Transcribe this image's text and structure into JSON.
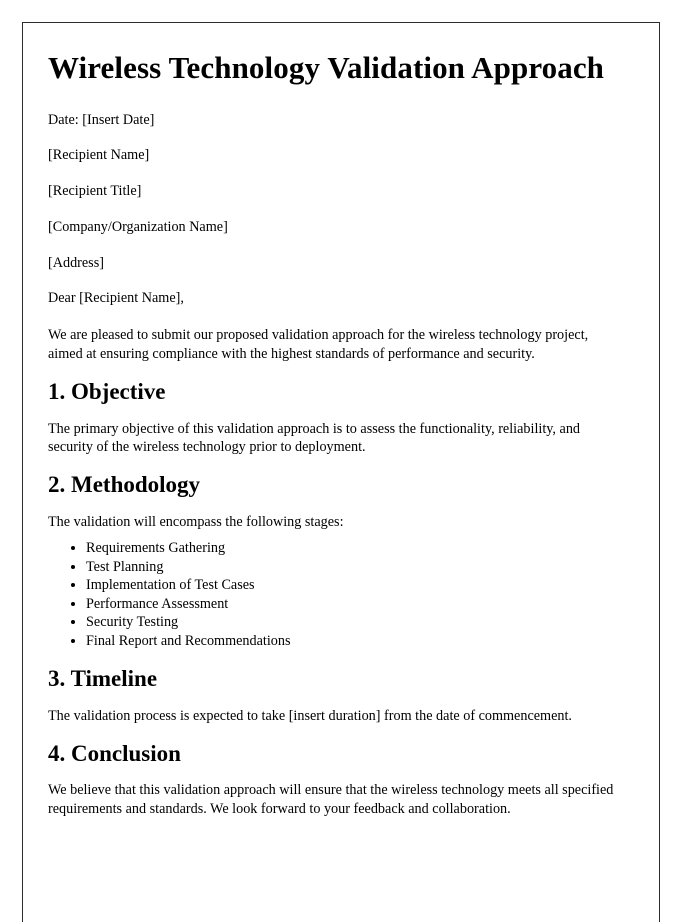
{
  "document": {
    "title": "Wireless Technology Validation Approach",
    "header_lines": [
      "Date: [Insert Date]",
      "[Recipient Name]",
      "[Recipient Title]",
      "[Company/Organization Name]",
      "[Address]"
    ],
    "salutation": "Dear [Recipient Name],",
    "intro_paragraph": "We are pleased to submit our proposed validation approach for the wireless technology project, aimed at ensuring compliance with the highest standards of performance and security.",
    "sections": [
      {
        "heading": "1. Objective",
        "body": "The primary objective of this validation approach is to assess the functionality, reliability, and security of the wireless technology prior to deployment."
      },
      {
        "heading": "2. Methodology",
        "body": "The validation will encompass the following stages:",
        "list": [
          "Requirements Gathering",
          "Test Planning",
          "Implementation of Test Cases",
          "Performance Assessment",
          "Security Testing",
          "Final Report and Recommendations"
        ]
      },
      {
        "heading": "3. Timeline",
        "body": "The validation process is expected to take [insert duration] from the date of commencement."
      },
      {
        "heading": "4. Conclusion",
        "body": "We believe that this validation approach will ensure that the wireless technology meets all specified requirements and standards. We look forward to your feedback and collaboration."
      }
    ]
  },
  "colors": {
    "page_background": "#ffffff",
    "page_border": "#2b2b2b",
    "text": "#000000"
  }
}
